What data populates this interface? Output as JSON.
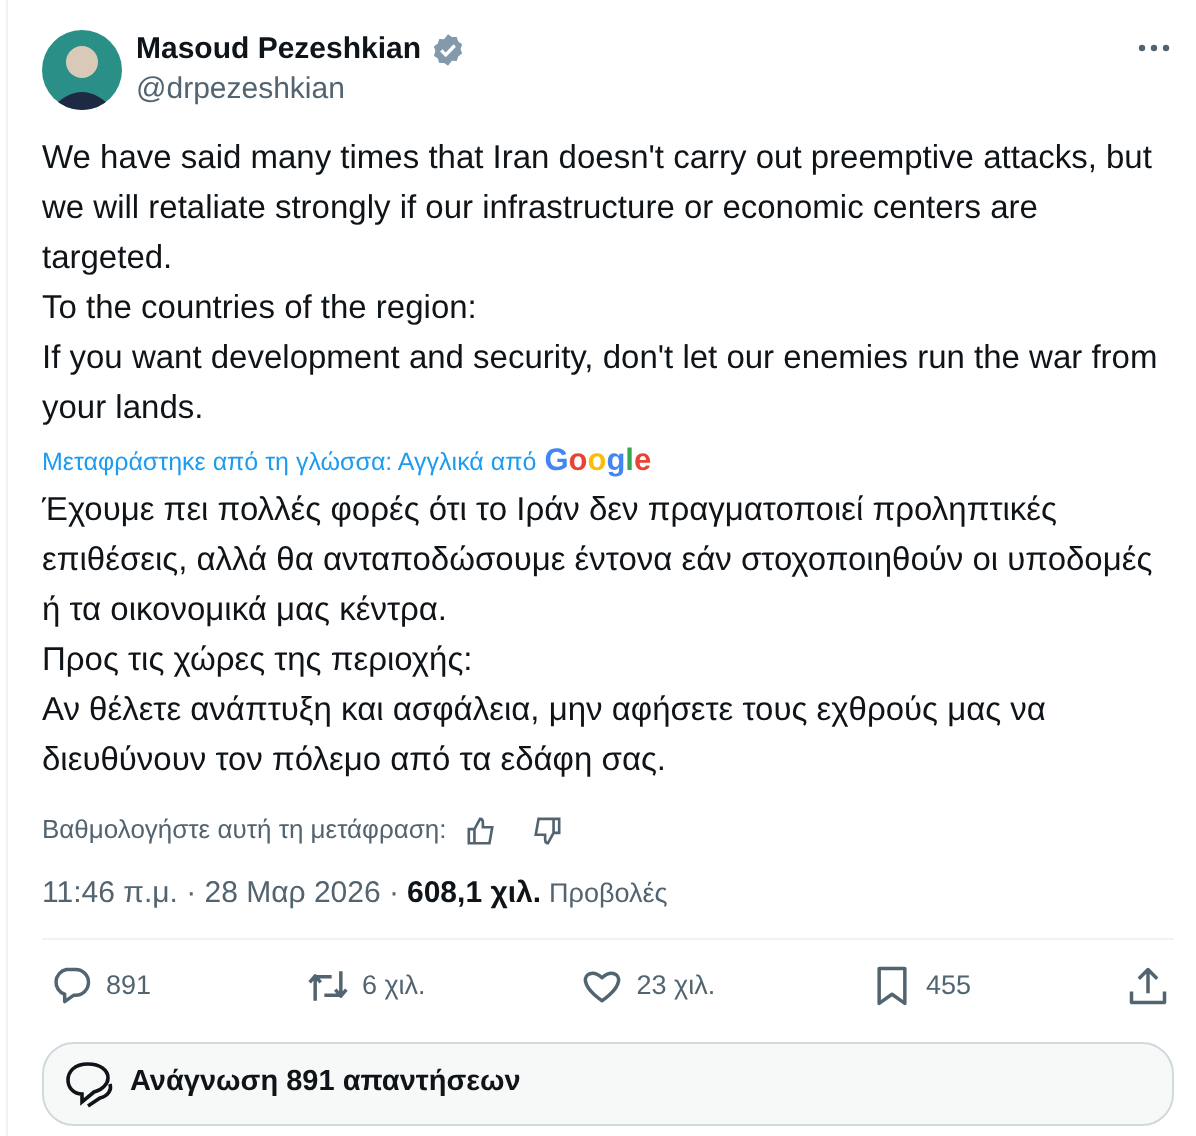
{
  "author": {
    "name": "Masoud Pezeshkian",
    "verified": true,
    "handle": "@drpezeshkian"
  },
  "text": [
    "We have said many times that Iran doesn't carry out preemptive attacks, but we will retaliate strongly if our infrastructure or economic centers are targeted.",
    "To the countries of the region:",
    "If you want development and security, don't let our enemies run the war from your lands."
  ],
  "translation_note": "Μεταφράστηκε από τη γλώσσα: Αγγλικά από",
  "translation_provider": "Google",
  "translation": [
    "Έχουμε πει πολλές φορές ότι το Ιράν δεν πραγματοποιεί προληπτικές επιθέσεις, αλλά θα ανταποδώσουμε έντονα εάν στοχοποιηθούν οι υποδομές ή τα οικονομικά μας κέντρα.",
    "Προς τις χώρες της περιοχής:",
    "Αν θέλετε ανάπτυξη και ασφάλεια, μην αφήσετε τους εχθρούς μας να διευθύνουν τον πόλεμο από τα εδάφη σας."
  ],
  "rate_prompt": "Βαθμολογήστε αυτή τη μετάφραση:",
  "timestamp": "11:46 π.μ. · 28 Μαρ 2026 ·",
  "views_count": "608,1 χιλ.",
  "views_label": "Προβολές",
  "actions": [
    {
      "kind": "reply",
      "count": "891"
    },
    {
      "kind": "repost",
      "count": "6 χιλ."
    },
    {
      "kind": "like",
      "count": "23 χιλ."
    },
    {
      "kind": "bookmark",
      "count": "455"
    },
    {
      "kind": "share"
    }
  ],
  "read_replies": "Ανάγνωση 891 απαντήσεων"
}
